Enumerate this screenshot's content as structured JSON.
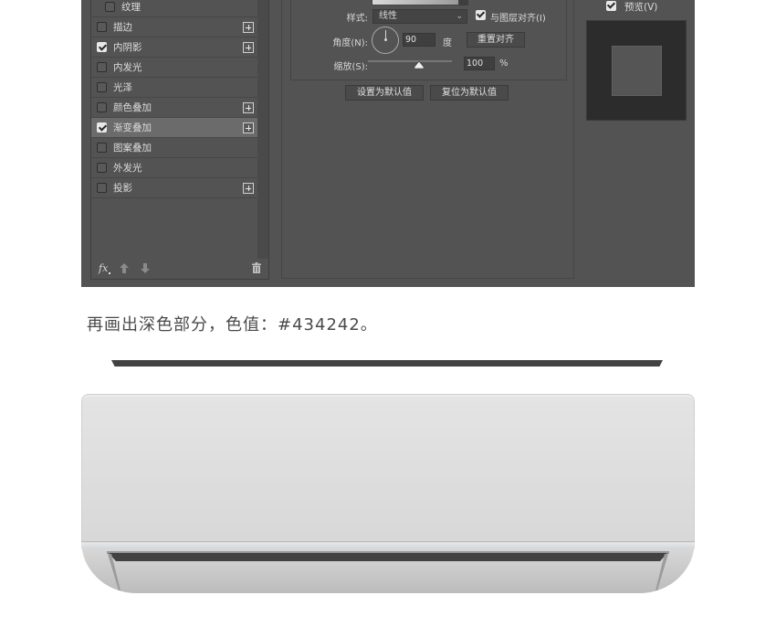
{
  "dialog": {
    "style_list": [
      {
        "label": "纹理",
        "checked": false,
        "sub": true,
        "plus": false,
        "selected": false
      },
      {
        "label": "描边",
        "checked": false,
        "sub": false,
        "plus": true,
        "selected": false
      },
      {
        "label": "内阴影",
        "checked": true,
        "sub": false,
        "plus": true,
        "selected": false
      },
      {
        "label": "内发光",
        "checked": false,
        "sub": false,
        "plus": false,
        "selected": false
      },
      {
        "label": "光泽",
        "checked": false,
        "sub": false,
        "plus": false,
        "selected": false
      },
      {
        "label": "颜色叠加",
        "checked": false,
        "sub": false,
        "plus": true,
        "selected": false
      },
      {
        "label": "渐变叠加",
        "checked": true,
        "sub": false,
        "plus": true,
        "selected": true
      },
      {
        "label": "图案叠加",
        "checked": false,
        "sub": false,
        "plus": false,
        "selected": false
      },
      {
        "label": "外发光",
        "checked": false,
        "sub": false,
        "plus": false,
        "selected": false
      },
      {
        "label": "投影",
        "checked": false,
        "sub": false,
        "plus": true,
        "selected": false
      }
    ],
    "footer": {
      "fx_label": "fx",
      "icons": [
        "fx-icon",
        "arrow-up-icon",
        "arrow-down-icon",
        "trash-icon"
      ]
    },
    "gradient": {
      "style_label": "样式:",
      "style_value": "线性",
      "align_label": "与图层对齐(I)",
      "align_checked": true,
      "angle_label": "角度(N):",
      "angle_value": "90",
      "angle_unit": "度",
      "reset_align_button": "重置对齐",
      "scale_label": "缩放(S):",
      "scale_value": "100",
      "scale_unit": "%",
      "scale_slider_percent": 100
    },
    "buttons": {
      "set_default": "设置为默认值",
      "reset_default": "复位为默认值"
    },
    "preview": {
      "label": "预览(V)",
      "checked": true
    }
  },
  "article": {
    "caption_prefix": "再画出深色部分，色值：",
    "caption_color": "#434242",
    "caption_suffix": "。",
    "dark_color": "#434242"
  }
}
